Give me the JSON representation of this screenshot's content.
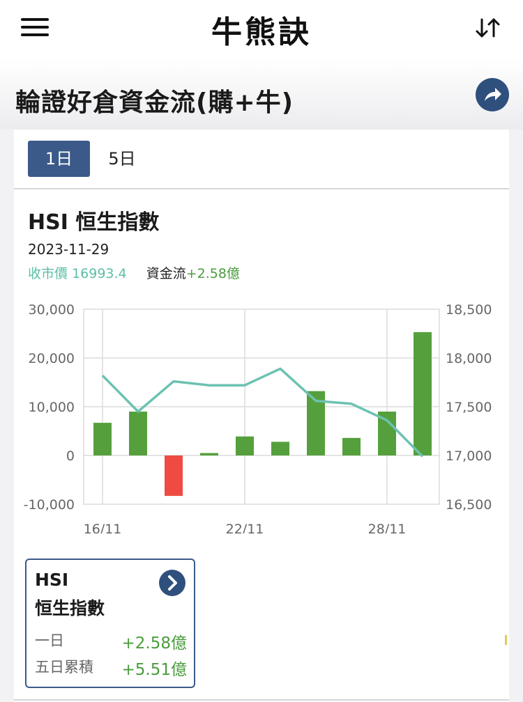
{
  "app": {
    "title": "牛熊訣",
    "menu_icon": "hamburger-menu-icon",
    "sort_icon": "sort-arrows-icon"
  },
  "page": {
    "title": "輪證好倉資金流(購+牛)",
    "share_icon": "share-arrow-icon"
  },
  "tabs": [
    {
      "label": "1日",
      "active": true
    },
    {
      "label": "5日",
      "active": false
    }
  ],
  "index": {
    "name": "HSI 恒生指數",
    "date": "2023-11-29",
    "close_label": "收市價",
    "close_value": "16993.4",
    "flow_label": "資金流",
    "flow_value": "+2.58億"
  },
  "chart_data": {
    "type": "bar",
    "x_tick_labels": [
      "16/11",
      "22/11",
      "28/11"
    ],
    "left_axis": {
      "ticks": [
        "30,000",
        "20,000",
        "10,000",
        "0",
        "-10,000"
      ],
      "range": [
        -10000,
        30000
      ]
    },
    "right_axis": {
      "ticks": [
        "18,500",
        "18,000",
        "17,500",
        "17,000",
        "16,500"
      ],
      "range": [
        16500,
        18500
      ]
    },
    "series": [
      {
        "values": [
          6700,
          9000,
          -8300,
          500,
          3900,
          2800,
          13200,
          3600,
          9000,
          25300
        ]
      },
      {
        "type": "line",
        "axis": "right",
        "values": [
          17820,
          17450,
          17760,
          17720,
          17720,
          17890,
          17560,
          17530,
          17360,
          16990
        ]
      }
    ],
    "colors": {
      "positive": "#55a03c",
      "negative": "#ef4b43",
      "line": "#6cc2b0"
    },
    "grid": true
  },
  "summary": {
    "code": "HSI",
    "name": "恒生指數",
    "arrow_icon": "chevron-right-icon",
    "rows": [
      {
        "label": "一日",
        "value": "+2.58億"
      },
      {
        "label": "五日累積",
        "value": "+5.51億"
      }
    ]
  }
}
